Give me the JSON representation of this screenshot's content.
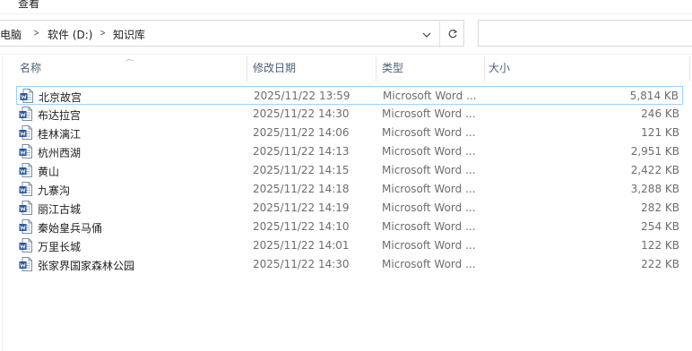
{
  "menu": {
    "view_label": "查看"
  },
  "address": {
    "crumbs": [
      "此电脑",
      "软件 (D:)",
      "知识库"
    ],
    "refresh_icon": "refresh-icon",
    "dropdown_icon": "chevron-down-icon"
  },
  "columns": {
    "name": "名称",
    "date": "修改日期",
    "type": "类型",
    "size": "大小"
  },
  "files": [
    {
      "name": "北京故宫",
      "date": "2025/11/22 13:59",
      "type": "Microsoft Word ...",
      "size": "5,814 KB",
      "selected": true
    },
    {
      "name": "布达拉宫",
      "date": "2025/11/22 14:30",
      "type": "Microsoft Word ...",
      "size": "246 KB"
    },
    {
      "name": "桂林漓江",
      "date": "2025/11/22 14:06",
      "type": "Microsoft Word ...",
      "size": "121 KB"
    },
    {
      "name": "杭州西湖",
      "date": "2025/11/22 14:13",
      "type": "Microsoft Word ...",
      "size": "2,951 KB"
    },
    {
      "name": "黄山",
      "date": "2025/11/22 14:15",
      "type": "Microsoft Word ...",
      "size": "2,422 KB"
    },
    {
      "name": "九寨沟",
      "date": "2025/11/22 14:18",
      "type": "Microsoft Word ...",
      "size": "3,288 KB"
    },
    {
      "name": "丽江古城",
      "date": "2025/11/22 14:19",
      "type": "Microsoft Word ...",
      "size": "282 KB"
    },
    {
      "name": "秦始皇兵马俑",
      "date": "2025/11/22 14:10",
      "type": "Microsoft Word ...",
      "size": "254 KB"
    },
    {
      "name": "万里长城",
      "date": "2025/11/22 14:01",
      "type": "Microsoft Word ...",
      "size": "122 KB"
    },
    {
      "name": "张家界国家森林公园",
      "date": "2025/11/22 14:30",
      "type": "Microsoft Word ...",
      "size": "222 KB"
    }
  ],
  "colors": {
    "accent": "#2b579a",
    "selection_border": "#99d1ff",
    "header_text": "#4c607a"
  }
}
